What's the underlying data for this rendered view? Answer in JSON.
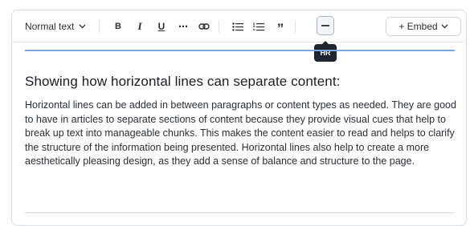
{
  "toolbar": {
    "text_style": "Normal text",
    "bold_label": "B",
    "italic_label": "I",
    "underline_label": "U",
    "more_label": "⋯",
    "link_icon": "link-icon",
    "bullet_list_icon": "bullet-list-icon",
    "numbered_list_icon": "numbered-list-icon",
    "quote_label": "”",
    "horizontal_rule_icon": "horizontal-rule-icon",
    "embed_label": "+ Embed"
  },
  "tooltip": {
    "text": "HR"
  },
  "content": {
    "heading": "Showing how horizontal lines can separate content:",
    "paragraph": "Horizontal lines can be added in between paragraphs or content types as needed. They are good to have in articles to separate sections of content because they provide visual cues that help to break up text into manageable chunks. This makes the content easier to read and helps to clarify the structure of the information being presented. Horizontal lines also help to create a more aesthetically pleasing design, as they add a sense of balance and structure to the page."
  },
  "colors": {
    "selected_rule": "#7ea7e6",
    "tooltip_bg": "#1e2430"
  }
}
